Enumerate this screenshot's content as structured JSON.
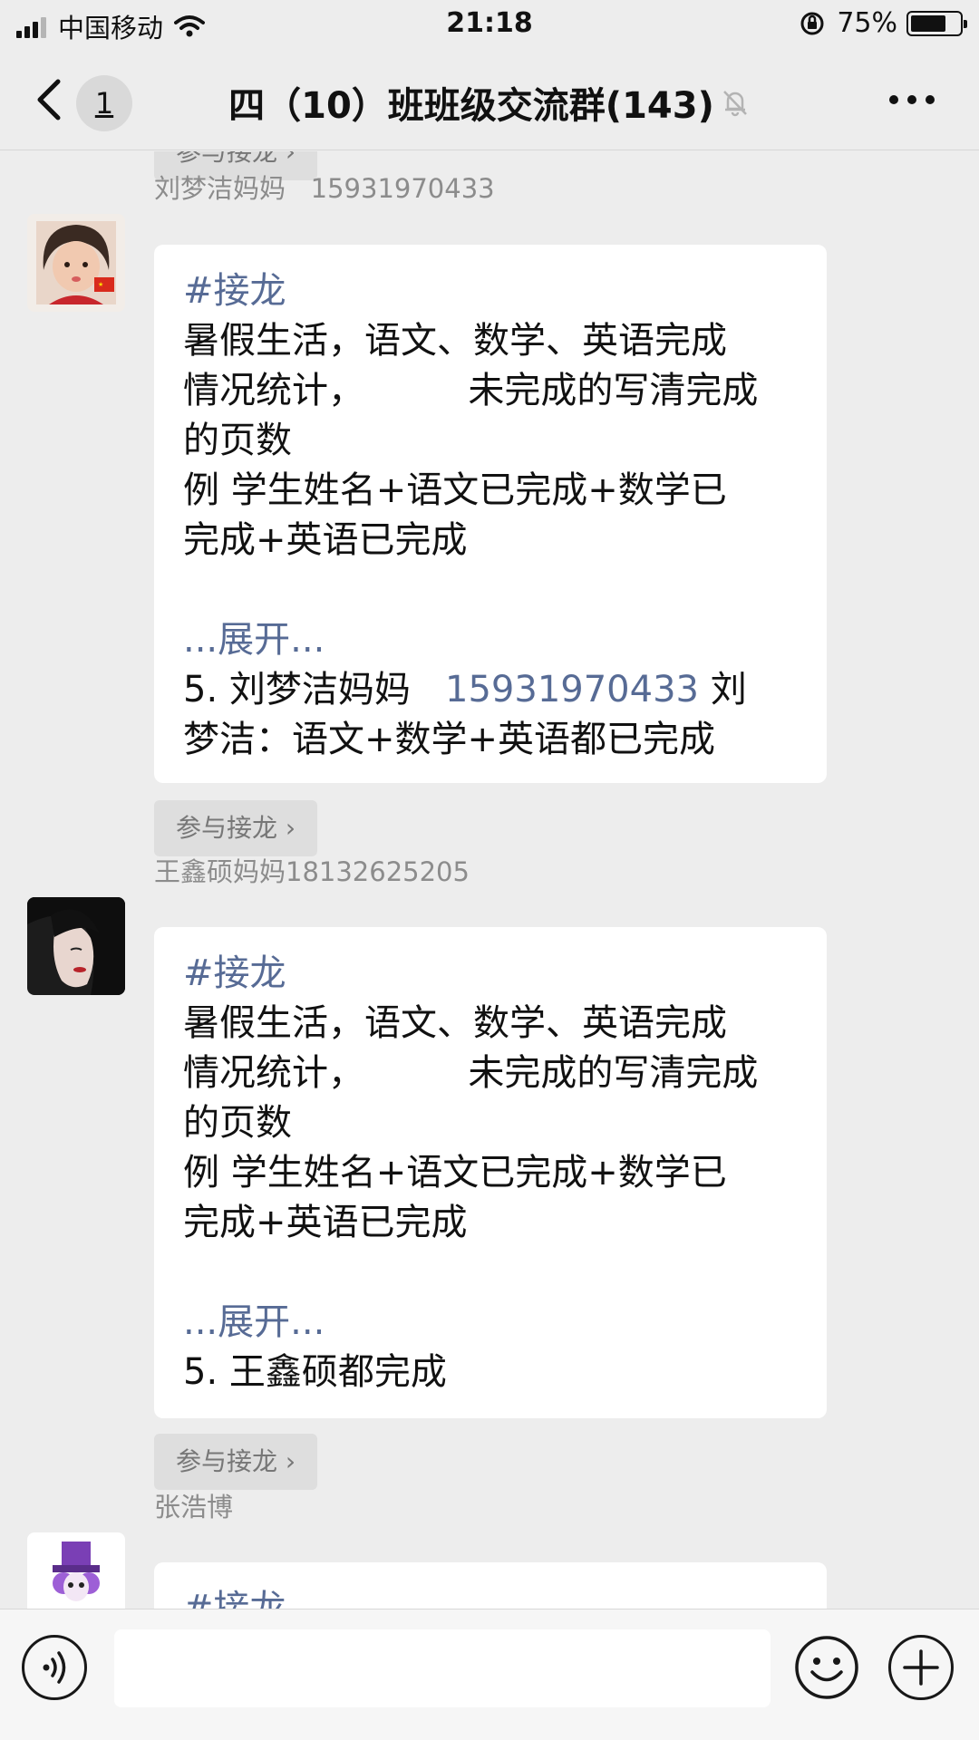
{
  "status_bar": {
    "carrier": "中国移动",
    "time": "21:18",
    "battery": "75%",
    "battery_level": 0.75
  },
  "nav": {
    "back_label": "",
    "unread_count": "1",
    "title": "四（10）班班级交流群(143)",
    "icons": [
      "back-chevron-icon",
      "bell-muted-icon",
      "more-dots-icon"
    ]
  },
  "messages": [
    {
      "sender": "",
      "join_label": "参与接龙 ›"
    },
    {
      "sender": "刘梦洁妈妈   15931970433",
      "tag": "#接龙",
      "lines": [
        "暑假生活，语文、数学、英语完成",
        "情况统计，         未完成的写清完成",
        "的页数",
        "例 学生姓名+语文已完成+数学已",
        "完成+英语已完成"
      ],
      "expand": "...展开...",
      "entry_prefix": "5. 刘梦洁妈妈   ",
      "entry_phone": "15931970433",
      "entry_suffix": " 刘",
      "entry_line2": "梦洁：语文+数学+英语都已完成",
      "join_label": "参与接龙 ›"
    },
    {
      "sender": "王鑫硕妈妈18132625205",
      "tag": "#接龙",
      "lines": [
        "暑假生活，语文、数学、英语完成",
        "情况统计，         未完成的写清完成",
        "的页数",
        "例 学生姓名+语文已完成+数学已",
        "完成+英语已完成"
      ],
      "expand": "...展开...",
      "entry": "5. 王鑫硕都完成",
      "join_label": "参与接龙 ›"
    },
    {
      "sender": "张浩博",
      "tag": "#接龙"
    }
  ],
  "input_bar": {
    "placeholder": "",
    "icons": [
      "voice-icon",
      "emoji-icon",
      "plus-icon"
    ]
  }
}
